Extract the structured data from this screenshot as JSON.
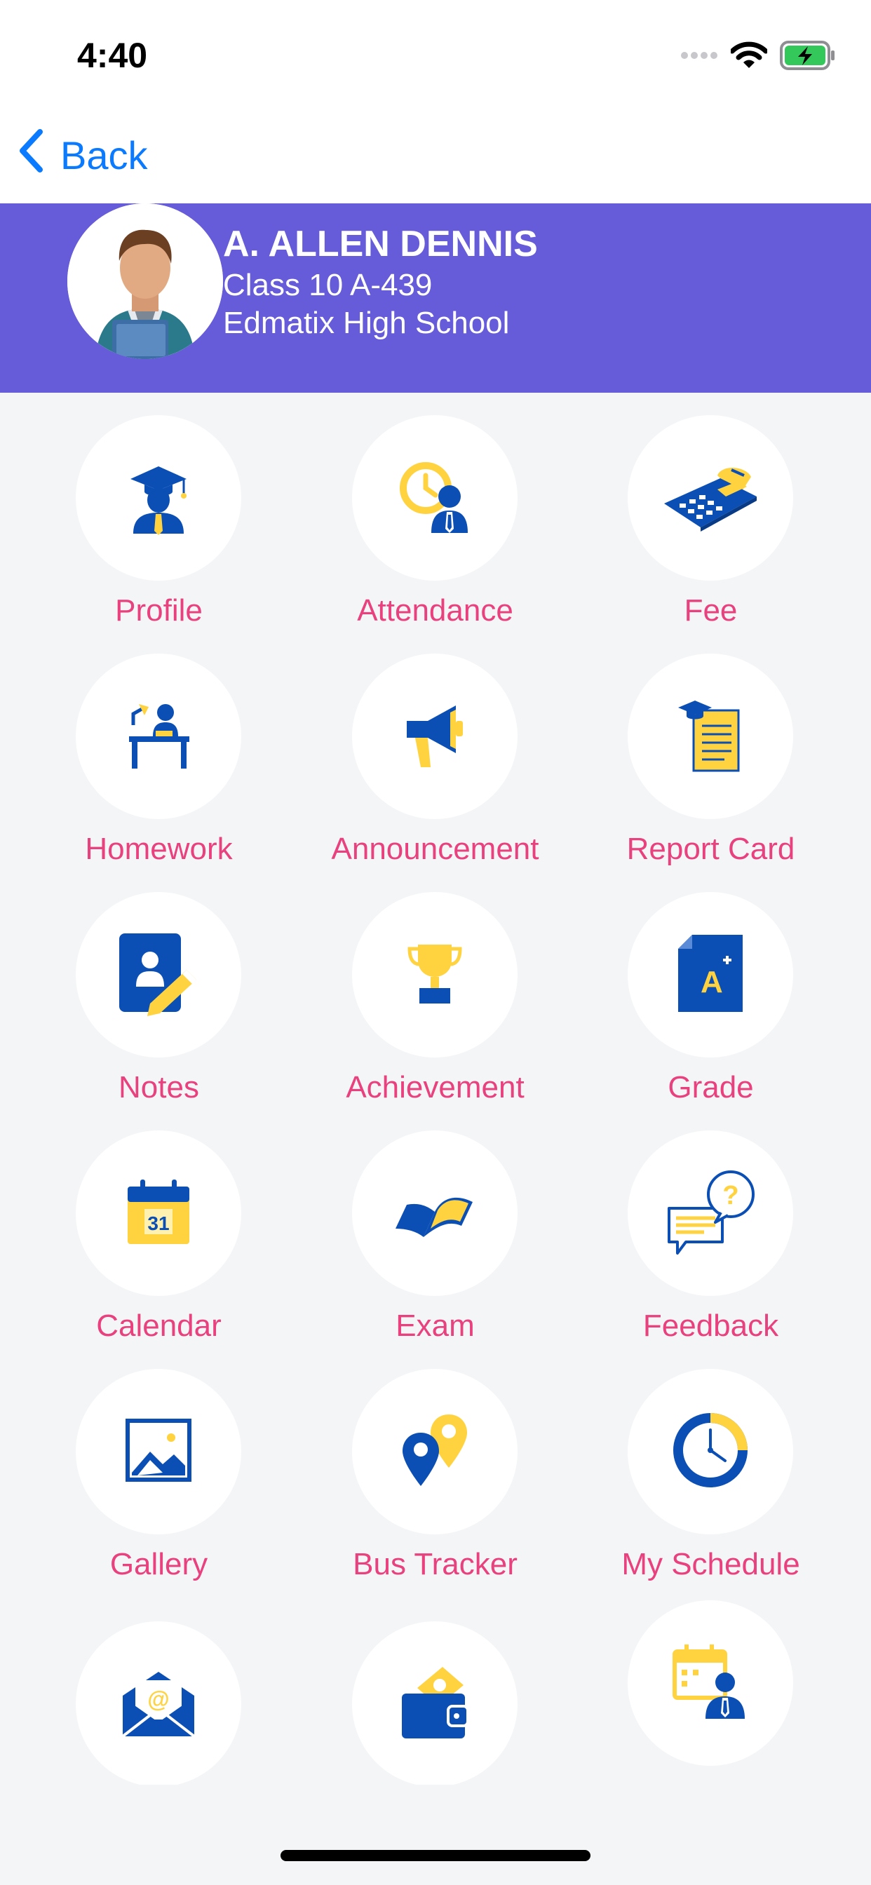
{
  "status_bar": {
    "time": "4:40",
    "signal_icon": "cellular-signal-icon",
    "wifi_icon": "wifi-icon",
    "battery_icon": "battery-charging-icon"
  },
  "nav": {
    "back_label": "Back",
    "back_icon": "chevron-left-icon"
  },
  "student": {
    "name": "A. ALLEN DENNIS",
    "class": "Class 10 A-439",
    "school": "Edmatix High School"
  },
  "colors": {
    "header_bg": "#665bd8",
    "label": "#e8417e",
    "icon_blue": "#0b4fb5",
    "icon_yellow": "#ffd23f",
    "accent_link": "#0a7aff"
  },
  "menu": [
    {
      "label": "Profile",
      "icon": "graduate-icon"
    },
    {
      "label": "Attendance",
      "icon": "attendance-clock-icon"
    },
    {
      "label": "Fee",
      "icon": "calculator-icon"
    },
    {
      "label": "Homework",
      "icon": "student-desk-icon"
    },
    {
      "label": "Announcement",
      "icon": "megaphone-icon"
    },
    {
      "label": "Report Card",
      "icon": "report-card-icon"
    },
    {
      "label": "Notes",
      "icon": "notes-pencil-icon"
    },
    {
      "label": "Achievement",
      "icon": "trophy-icon"
    },
    {
      "label": "Grade",
      "icon": "grade-a-plus-icon",
      "icon_text": "A"
    },
    {
      "label": "Calendar",
      "icon": "calendar-icon",
      "icon_text": "31"
    },
    {
      "label": "Exam",
      "icon": "open-book-icon"
    },
    {
      "label": "Feedback",
      "icon": "feedback-chat-icon",
      "icon_text": "?"
    },
    {
      "label": "Gallery",
      "icon": "image-gallery-icon"
    },
    {
      "label": "Bus Tracker",
      "icon": "map-pins-icon"
    },
    {
      "label": "My Schedule",
      "icon": "clock-schedule-icon"
    },
    {
      "label": "",
      "icon": "mail-envelope-icon",
      "icon_text": "@"
    },
    {
      "label": "",
      "icon": "wallet-icon"
    },
    {
      "label": "",
      "icon": "teacher-calendar-icon"
    }
  ]
}
